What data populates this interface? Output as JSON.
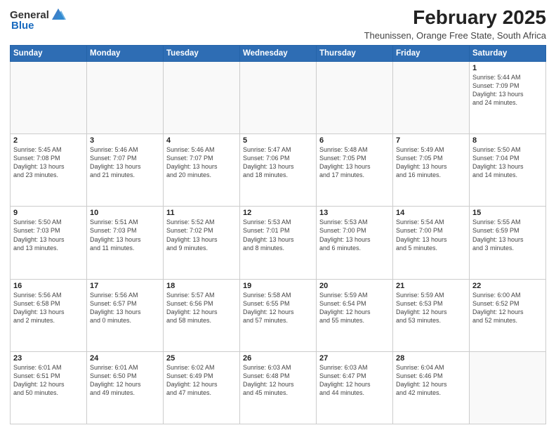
{
  "header": {
    "logo_general": "General",
    "logo_blue": "Blue",
    "month_year": "February 2025",
    "location": "Theunissen, Orange Free State, South Africa"
  },
  "weekdays": [
    "Sunday",
    "Monday",
    "Tuesday",
    "Wednesday",
    "Thursday",
    "Friday",
    "Saturday"
  ],
  "weeks": [
    [
      {
        "day": "",
        "info": ""
      },
      {
        "day": "",
        "info": ""
      },
      {
        "day": "",
        "info": ""
      },
      {
        "day": "",
        "info": ""
      },
      {
        "day": "",
        "info": ""
      },
      {
        "day": "",
        "info": ""
      },
      {
        "day": "1",
        "info": "Sunrise: 5:44 AM\nSunset: 7:09 PM\nDaylight: 13 hours\nand 24 minutes."
      }
    ],
    [
      {
        "day": "2",
        "info": "Sunrise: 5:45 AM\nSunset: 7:08 PM\nDaylight: 13 hours\nand 23 minutes."
      },
      {
        "day": "3",
        "info": "Sunrise: 5:46 AM\nSunset: 7:07 PM\nDaylight: 13 hours\nand 21 minutes."
      },
      {
        "day": "4",
        "info": "Sunrise: 5:46 AM\nSunset: 7:07 PM\nDaylight: 13 hours\nand 20 minutes."
      },
      {
        "day": "5",
        "info": "Sunrise: 5:47 AM\nSunset: 7:06 PM\nDaylight: 13 hours\nand 18 minutes."
      },
      {
        "day": "6",
        "info": "Sunrise: 5:48 AM\nSunset: 7:05 PM\nDaylight: 13 hours\nand 17 minutes."
      },
      {
        "day": "7",
        "info": "Sunrise: 5:49 AM\nSunset: 7:05 PM\nDaylight: 13 hours\nand 16 minutes."
      },
      {
        "day": "8",
        "info": "Sunrise: 5:50 AM\nSunset: 7:04 PM\nDaylight: 13 hours\nand 14 minutes."
      }
    ],
    [
      {
        "day": "9",
        "info": "Sunrise: 5:50 AM\nSunset: 7:03 PM\nDaylight: 13 hours\nand 13 minutes."
      },
      {
        "day": "10",
        "info": "Sunrise: 5:51 AM\nSunset: 7:03 PM\nDaylight: 13 hours\nand 11 minutes."
      },
      {
        "day": "11",
        "info": "Sunrise: 5:52 AM\nSunset: 7:02 PM\nDaylight: 13 hours\nand 9 minutes."
      },
      {
        "day": "12",
        "info": "Sunrise: 5:53 AM\nSunset: 7:01 PM\nDaylight: 13 hours\nand 8 minutes."
      },
      {
        "day": "13",
        "info": "Sunrise: 5:53 AM\nSunset: 7:00 PM\nDaylight: 13 hours\nand 6 minutes."
      },
      {
        "day": "14",
        "info": "Sunrise: 5:54 AM\nSunset: 7:00 PM\nDaylight: 13 hours\nand 5 minutes."
      },
      {
        "day": "15",
        "info": "Sunrise: 5:55 AM\nSunset: 6:59 PM\nDaylight: 13 hours\nand 3 minutes."
      }
    ],
    [
      {
        "day": "16",
        "info": "Sunrise: 5:56 AM\nSunset: 6:58 PM\nDaylight: 13 hours\nand 2 minutes."
      },
      {
        "day": "17",
        "info": "Sunrise: 5:56 AM\nSunset: 6:57 PM\nDaylight: 13 hours\nand 0 minutes."
      },
      {
        "day": "18",
        "info": "Sunrise: 5:57 AM\nSunset: 6:56 PM\nDaylight: 12 hours\nand 58 minutes."
      },
      {
        "day": "19",
        "info": "Sunrise: 5:58 AM\nSunset: 6:55 PM\nDaylight: 12 hours\nand 57 minutes."
      },
      {
        "day": "20",
        "info": "Sunrise: 5:59 AM\nSunset: 6:54 PM\nDaylight: 12 hours\nand 55 minutes."
      },
      {
        "day": "21",
        "info": "Sunrise: 5:59 AM\nSunset: 6:53 PM\nDaylight: 12 hours\nand 53 minutes."
      },
      {
        "day": "22",
        "info": "Sunrise: 6:00 AM\nSunset: 6:52 PM\nDaylight: 12 hours\nand 52 minutes."
      }
    ],
    [
      {
        "day": "23",
        "info": "Sunrise: 6:01 AM\nSunset: 6:51 PM\nDaylight: 12 hours\nand 50 minutes."
      },
      {
        "day": "24",
        "info": "Sunrise: 6:01 AM\nSunset: 6:50 PM\nDaylight: 12 hours\nand 49 minutes."
      },
      {
        "day": "25",
        "info": "Sunrise: 6:02 AM\nSunset: 6:49 PM\nDaylight: 12 hours\nand 47 minutes."
      },
      {
        "day": "26",
        "info": "Sunrise: 6:03 AM\nSunset: 6:48 PM\nDaylight: 12 hours\nand 45 minutes."
      },
      {
        "day": "27",
        "info": "Sunrise: 6:03 AM\nSunset: 6:47 PM\nDaylight: 12 hours\nand 44 minutes."
      },
      {
        "day": "28",
        "info": "Sunrise: 6:04 AM\nSunset: 6:46 PM\nDaylight: 12 hours\nand 42 minutes."
      },
      {
        "day": "",
        "info": ""
      }
    ]
  ]
}
